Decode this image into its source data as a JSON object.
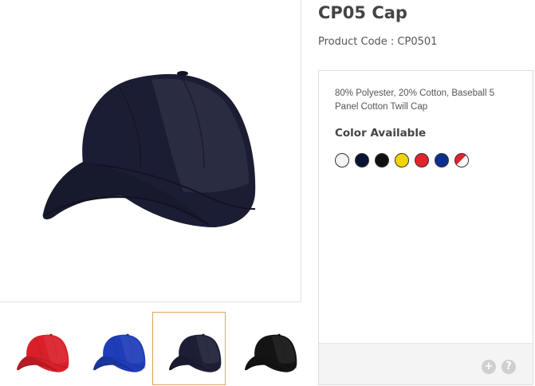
{
  "product": {
    "title": "CP05 Cap",
    "code_text": "Product Code : CP0501",
    "description": "80% Polyester, 20% Cotton, Baseball 5 Panel Cotton Twill Cap"
  },
  "colors": {
    "heading": "Color Available",
    "swatches": [
      {
        "name": "white",
        "hex": "#f4f4f4"
      },
      {
        "name": "navy",
        "hex": "#0b1236"
      },
      {
        "name": "black",
        "hex": "#111111"
      },
      {
        "name": "yellow",
        "hex": "#f3d400"
      },
      {
        "name": "red",
        "hex": "#e0242b"
      },
      {
        "name": "royal-blue",
        "hex": "#0a2f8f"
      },
      {
        "name": "red-white",
        "hex": "#e0242b"
      }
    ]
  },
  "thumbnails": [
    {
      "name": "red",
      "hex": "#d9202a",
      "selected": false
    },
    {
      "name": "royal-blue",
      "hex": "#1f3db8",
      "selected": false
    },
    {
      "name": "navy",
      "hex": "#1d1f36",
      "selected": true
    },
    {
      "name": "black",
      "hex": "#141414",
      "selected": false
    }
  ],
  "footer": {
    "plus_label": "+",
    "help_label": "?"
  },
  "main_image": {
    "hex": "#1b1d34"
  }
}
